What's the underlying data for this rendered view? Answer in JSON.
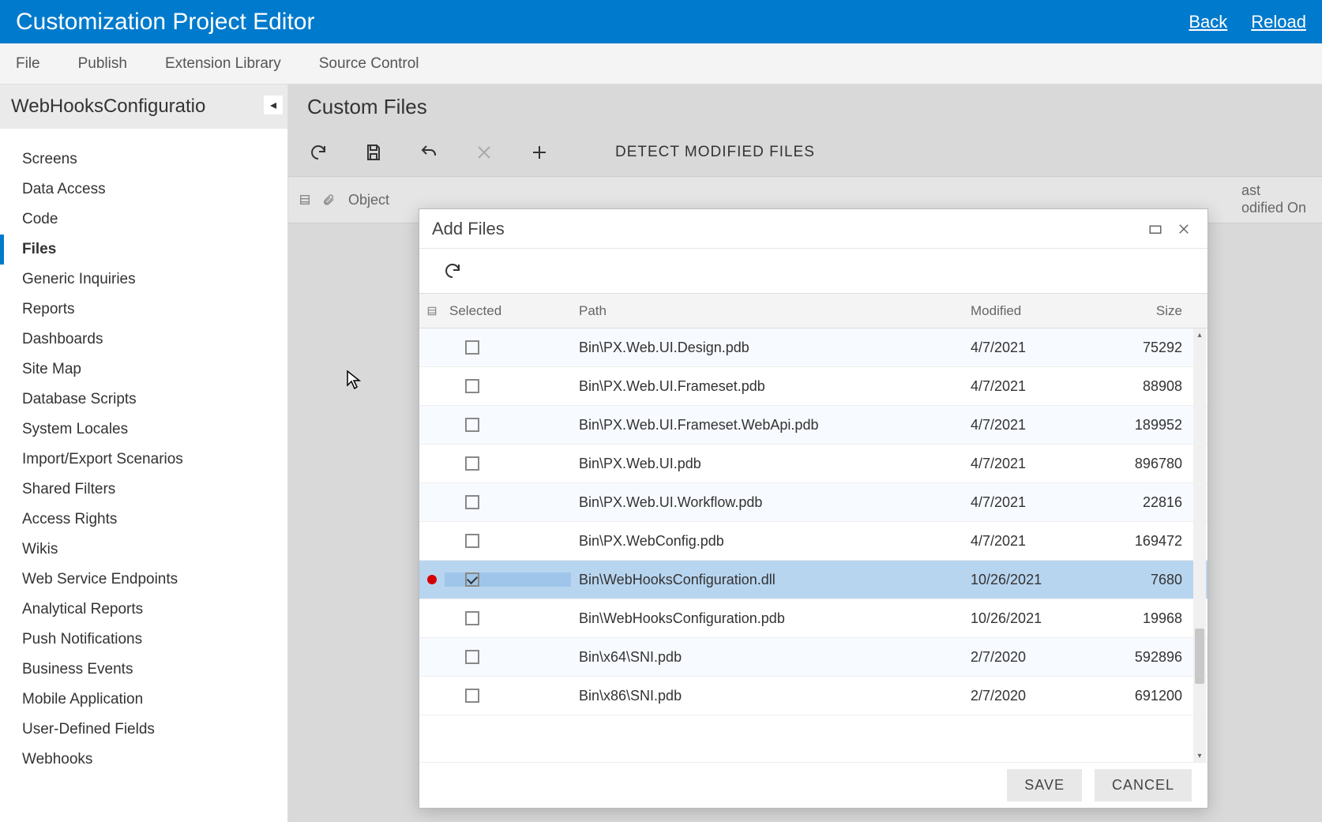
{
  "header": {
    "title": "Customization Project Editor",
    "links": {
      "back": "Back",
      "reload": "Reload"
    }
  },
  "menu": {
    "file": "File",
    "publish": "Publish",
    "ext": "Extension Library",
    "src": "Source Control"
  },
  "sidebar": {
    "project_name": "WebHooksConfiguratio",
    "items": [
      "Screens",
      "Data Access",
      "Code",
      "Files",
      "Generic Inquiries",
      "Reports",
      "Dashboards",
      "Site Map",
      "Database Scripts",
      "System Locales",
      "Import/Export Scenarios",
      "Shared Filters",
      "Access Rights",
      "Wikis",
      "Web Service Endpoints",
      "Analytical Reports",
      "Push Notifications",
      "Business Events",
      "Mobile Application",
      "User-Defined Fields",
      "Webhooks"
    ],
    "active_index": 3
  },
  "main": {
    "title": "Custom Files",
    "detect": "DETECT MODIFIED FILES",
    "col_object": "Object",
    "col_last1": "ast",
    "col_last2": "odified On"
  },
  "dialog": {
    "title": "Add Files",
    "cols": {
      "sel": "Selected",
      "path": "Path",
      "mod": "Modified",
      "size": "Size"
    },
    "rows": [
      {
        "path": "Bin\\PX.Web.UI.Design.pdb",
        "mod": "4/7/2021",
        "size": "75292",
        "checked": false,
        "dirty": false
      },
      {
        "path": "Bin\\PX.Web.UI.Frameset.pdb",
        "mod": "4/7/2021",
        "size": "88908",
        "checked": false,
        "dirty": false
      },
      {
        "path": "Bin\\PX.Web.UI.Frameset.WebApi.pdb",
        "mod": "4/7/2021",
        "size": "189952",
        "checked": false,
        "dirty": false
      },
      {
        "path": "Bin\\PX.Web.UI.pdb",
        "mod": "4/7/2021",
        "size": "896780",
        "checked": false,
        "dirty": false
      },
      {
        "path": "Bin\\PX.Web.UI.Workflow.pdb",
        "mod": "4/7/2021",
        "size": "22816",
        "checked": false,
        "dirty": false
      },
      {
        "path": "Bin\\PX.WebConfig.pdb",
        "mod": "4/7/2021",
        "size": "169472",
        "checked": false,
        "dirty": false
      },
      {
        "path": "Bin\\WebHooksConfiguration.dll",
        "mod": "10/26/2021",
        "size": "7680",
        "checked": true,
        "dirty": true
      },
      {
        "path": "Bin\\WebHooksConfiguration.pdb",
        "mod": "10/26/2021",
        "size": "19968",
        "checked": false,
        "dirty": false
      },
      {
        "path": "Bin\\x64\\SNI.pdb",
        "mod": "2/7/2020",
        "size": "592896",
        "checked": false,
        "dirty": false
      },
      {
        "path": "Bin\\x86\\SNI.pdb",
        "mod": "2/7/2020",
        "size": "691200",
        "checked": false,
        "dirty": false
      }
    ],
    "selected_row": 6,
    "buttons": {
      "save": "SAVE",
      "cancel": "CANCEL"
    }
  }
}
